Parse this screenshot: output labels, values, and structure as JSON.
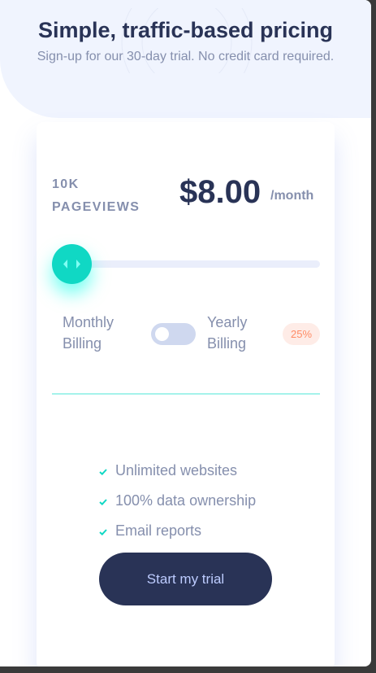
{
  "header": {
    "title": "Simple, traffic-based pricing",
    "subtitle": "Sign-up for our 30-day trial. No credit card required."
  },
  "pricing": {
    "pageviews_label": "10K PAGEVIEWS",
    "price": "$8.00",
    "period": "/month",
    "slider_value_fraction": 0.0
  },
  "billing": {
    "monthly_label": "Monthly Billing",
    "yearly_label": "Yearly Billing",
    "yearly_enabled": false,
    "discount_badge": "25%"
  },
  "features": [
    {
      "label": "Unlimited websites",
      "icon": "check-icon"
    },
    {
      "label": "100% data ownership",
      "icon": "check-icon"
    },
    {
      "label": "Email reports",
      "icon": "check-icon"
    }
  ],
  "cta": {
    "label": "Start my trial"
  },
  "colors": {
    "accent": "#10d8c4",
    "dark_blue": "#293356",
    "grayish_blue": "#858fad",
    "discount_text": "#ff8c66"
  }
}
